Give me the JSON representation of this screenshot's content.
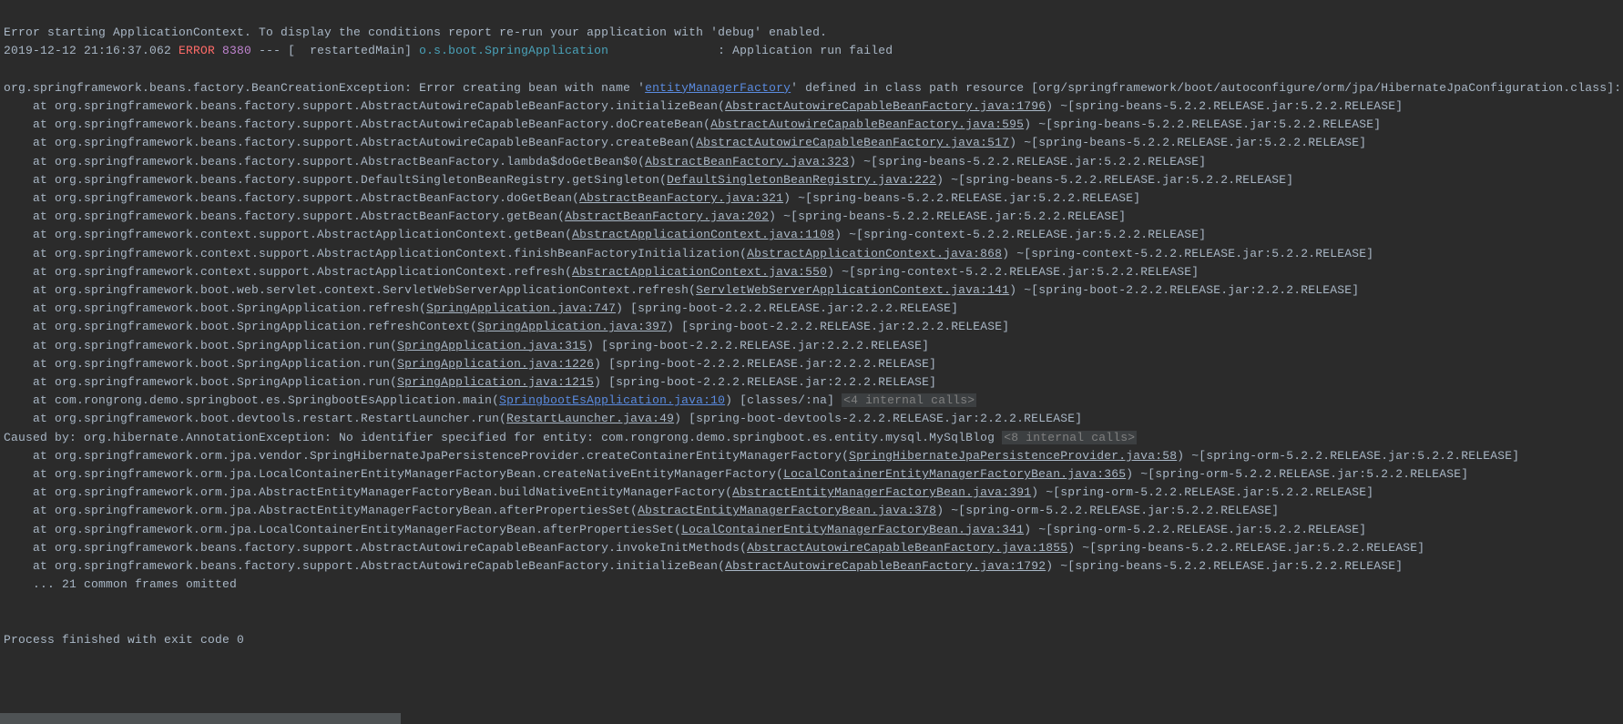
{
  "header": {
    "intro": "Error starting ApplicationContext. To display the conditions report re-run your application with 'debug' enabled.",
    "ts": "2019-12-12 21:16:37.062 ",
    "level": "ERROR",
    "pid": " 8380",
    "thread": " --- [  restartedMain] ",
    "logger": "o.s.boot.SpringApplication",
    "pad": "               ",
    "msg": ": Application run failed"
  },
  "blank1": "",
  "ex": {
    "pre": "org.springframework.beans.factory.BeanCreationException: Error creating bean with name '",
    "bean": "entityManagerFactory",
    "post": "' defined in class path resource [org/springframework/boot/autoconfigure/orm/jpa/HibernateJpaConfiguration.class]:"
  },
  "s": [
    {
      "p": "    at org.springframework.beans.factory.support.AbstractAutowireCapableBeanFactory.initializeBean(",
      "l": "AbstractAutowireCapableBeanFactory.java:1796",
      "a": ") ~[spring-beans-5.2.2.RELEASE.jar:5.2.2.RELEASE]"
    },
    {
      "p": "    at org.springframework.beans.factory.support.AbstractAutowireCapableBeanFactory.doCreateBean(",
      "l": "AbstractAutowireCapableBeanFactory.java:595",
      "a": ") ~[spring-beans-5.2.2.RELEASE.jar:5.2.2.RELEASE]"
    },
    {
      "p": "    at org.springframework.beans.factory.support.AbstractAutowireCapableBeanFactory.createBean(",
      "l": "AbstractAutowireCapableBeanFactory.java:517",
      "a": ") ~[spring-beans-5.2.2.RELEASE.jar:5.2.2.RELEASE]"
    },
    {
      "p": "    at org.springframework.beans.factory.support.AbstractBeanFactory.lambda$doGetBean$0(",
      "l": "AbstractBeanFactory.java:323",
      "a": ") ~[spring-beans-5.2.2.RELEASE.jar:5.2.2.RELEASE]"
    },
    {
      "p": "    at org.springframework.beans.factory.support.DefaultSingletonBeanRegistry.getSingleton(",
      "l": "DefaultSingletonBeanRegistry.java:222",
      "a": ") ~[spring-beans-5.2.2.RELEASE.jar:5.2.2.RELEASE]"
    },
    {
      "p": "    at org.springframework.beans.factory.support.AbstractBeanFactory.doGetBean(",
      "l": "AbstractBeanFactory.java:321",
      "a": ") ~[spring-beans-5.2.2.RELEASE.jar:5.2.2.RELEASE]"
    },
    {
      "p": "    at org.springframework.beans.factory.support.AbstractBeanFactory.getBean(",
      "l": "AbstractBeanFactory.java:202",
      "a": ") ~[spring-beans-5.2.2.RELEASE.jar:5.2.2.RELEASE]"
    },
    {
      "p": "    at org.springframework.context.support.AbstractApplicationContext.getBean(",
      "l": "AbstractApplicationContext.java:1108",
      "a": ") ~[spring-context-5.2.2.RELEASE.jar:5.2.2.RELEASE]"
    },
    {
      "p": "    at org.springframework.context.support.AbstractApplicationContext.finishBeanFactoryInitialization(",
      "l": "AbstractApplicationContext.java:868",
      "a": ") ~[spring-context-5.2.2.RELEASE.jar:5.2.2.RELEASE]"
    },
    {
      "p": "    at org.springframework.context.support.AbstractApplicationContext.refresh(",
      "l": "AbstractApplicationContext.java:550",
      "a": ") ~[spring-context-5.2.2.RELEASE.jar:5.2.2.RELEASE]"
    },
    {
      "p": "    at org.springframework.boot.web.servlet.context.ServletWebServerApplicationContext.refresh(",
      "l": "ServletWebServerApplicationContext.java:141",
      "a": ") ~[spring-boot-2.2.2.RELEASE.jar:2.2.2.RELEASE]"
    },
    {
      "p": "    at org.springframework.boot.SpringApplication.refresh(",
      "l": "SpringApplication.java:747",
      "a": ") [spring-boot-2.2.2.RELEASE.jar:2.2.2.RELEASE]"
    },
    {
      "p": "    at org.springframework.boot.SpringApplication.refreshContext(",
      "l": "SpringApplication.java:397",
      "a": ") [spring-boot-2.2.2.RELEASE.jar:2.2.2.RELEASE]"
    },
    {
      "p": "    at org.springframework.boot.SpringApplication.run(",
      "l": "SpringApplication.java:315",
      "a": ") [spring-boot-2.2.2.RELEASE.jar:2.2.2.RELEASE]"
    },
    {
      "p": "    at org.springframework.boot.SpringApplication.run(",
      "l": "SpringApplication.java:1226",
      "a": ") [spring-boot-2.2.2.RELEASE.jar:2.2.2.RELEASE]"
    },
    {
      "p": "    at org.springframework.boot.SpringApplication.run(",
      "l": "SpringApplication.java:1215",
      "a": ") [spring-boot-2.2.2.RELEASE.jar:2.2.2.RELEASE]"
    }
  ],
  "mainline": {
    "p": "    at com.rongrong.demo.springboot.es.SpringbootEsApplication.main(",
    "l": "SpringbootEsApplication.java:10",
    "a": ") [classes/:na] ",
    "fold": "<4 internal calls>"
  },
  "restart": {
    "p": "    at org.springframework.boot.devtools.restart.RestartLauncher.run(",
    "l": "RestartLauncher.java:49",
    "a": ") [spring-boot-devtools-2.2.2.RELEASE.jar:2.2.2.RELEASE]"
  },
  "cause": {
    "p": "Caused by: org.hibernate.AnnotationException: No identifier specified for entity: com.rongrong.demo.springboot.es.entity.mysql.MySqlBlog ",
    "fold": "<8 internal calls>"
  },
  "c": [
    {
      "p": "    at org.springframework.orm.jpa.vendor.SpringHibernateJpaPersistenceProvider.createContainerEntityManagerFactory(",
      "l": "SpringHibernateJpaPersistenceProvider.java:58",
      "a": ") ~[spring-orm-5.2.2.RELEASE.jar:5.2.2.RELEASE]"
    },
    {
      "p": "    at org.springframework.orm.jpa.LocalContainerEntityManagerFactoryBean.createNativeEntityManagerFactory(",
      "l": "LocalContainerEntityManagerFactoryBean.java:365",
      "a": ") ~[spring-orm-5.2.2.RELEASE.jar:5.2.2.RELEASE]"
    },
    {
      "p": "    at org.springframework.orm.jpa.AbstractEntityManagerFactoryBean.buildNativeEntityManagerFactory(",
      "l": "AbstractEntityManagerFactoryBean.java:391",
      "a": ") ~[spring-orm-5.2.2.RELEASE.jar:5.2.2.RELEASE]"
    },
    {
      "p": "    at org.springframework.orm.jpa.AbstractEntityManagerFactoryBean.afterPropertiesSet(",
      "l": "AbstractEntityManagerFactoryBean.java:378",
      "a": ") ~[spring-orm-5.2.2.RELEASE.jar:5.2.2.RELEASE]"
    },
    {
      "p": "    at org.springframework.orm.jpa.LocalContainerEntityManagerFactoryBean.afterPropertiesSet(",
      "l": "LocalContainerEntityManagerFactoryBean.java:341",
      "a": ") ~[spring-orm-5.2.2.RELEASE.jar:5.2.2.RELEASE]"
    },
    {
      "p": "    at org.springframework.beans.factory.support.AbstractAutowireCapableBeanFactory.invokeInitMethods(",
      "l": "AbstractAutowireCapableBeanFactory.java:1855",
      "a": ") ~[spring-beans-5.2.2.RELEASE.jar:5.2.2.RELEASE]"
    },
    {
      "p": "    at org.springframework.beans.factory.support.AbstractAutowireCapableBeanFactory.initializeBean(",
      "l": "AbstractAutowireCapableBeanFactory.java:1792",
      "a": ") ~[spring-beans-5.2.2.RELEASE.jar:5.2.2.RELEASE]"
    }
  ],
  "omitted": "    ... 21 common frames omitted",
  "blank2": "",
  "blank3": "",
  "exit": "Process finished with exit code 0"
}
